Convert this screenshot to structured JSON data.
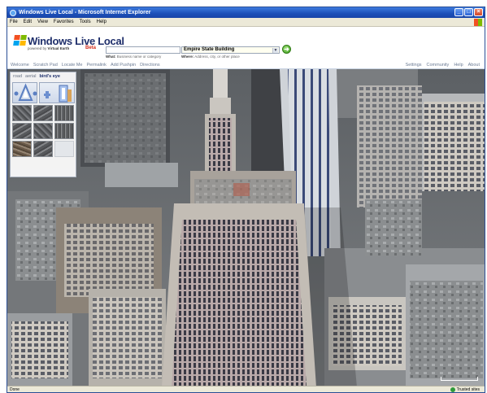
{
  "window": {
    "title": "Windows Live Local - Microsoft Internet Explorer",
    "controls": [
      "_",
      "□",
      "×"
    ]
  },
  "menu": [
    "File",
    "Edit",
    "View",
    "Favorites",
    "Tools",
    "Help"
  ],
  "header": {
    "logo_text": "Windows Live Local",
    "logo_powered_prefix": "powered by",
    "logo_powered_name": "Virtual Earth",
    "beta_label": "Beta",
    "what_value": "",
    "where_value": "Empire State Building",
    "what_hint_label": "What:",
    "what_hint_text": "Business name or category",
    "where_hint_label": "Where:",
    "where_hint_text": "Address, city, or other place",
    "go_label": "➜"
  },
  "nav": {
    "left": [
      "Welcome",
      "Scratch Pad",
      "Locate Me",
      "Permalink",
      "Add Pushpin",
      "Directions"
    ],
    "right": [
      "Settings",
      "Community",
      "Help",
      "About"
    ]
  },
  "map_panel": {
    "tabs": [
      "road",
      "aerial",
      "bird's eye"
    ],
    "active_tab": "bird's eye"
  },
  "status": {
    "left_text": "Done",
    "zone_text": "Trusted sites"
  }
}
